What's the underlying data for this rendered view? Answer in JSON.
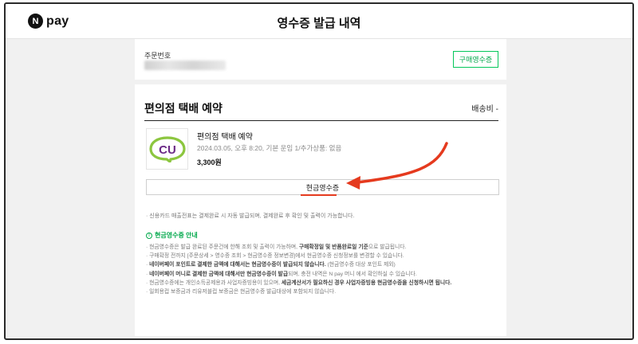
{
  "header": {
    "logo_n": "N",
    "logo_text": "pay",
    "title": "영수증 발급 내역"
  },
  "order": {
    "label": "주문번호",
    "purchase_receipt_button": "구매영수증"
  },
  "section": {
    "title": "편의점 택배 예약",
    "shipping_fee": "배송비 -"
  },
  "item": {
    "logo_text": "CU",
    "name": "편의점 택배 예약",
    "detail": "2024.03.05, 오후 8:20, 기본 운임 1/추가상품: 없음",
    "price": "3,300원"
  },
  "cash_receipt_button": "현금영수증",
  "notes": {
    "card_note": "· 신용카드 매출전표는 결제완료 시 자동 발급되며, 결제완료 후 확인 및 출력이 가능합니다."
  },
  "guide": {
    "icon": "!",
    "title": "현금영수증 안내",
    "items": [
      {
        "pre": "· 현금영수증은 발급 완료된 주문건에 한해 조회 및 출력이 가능하며, ",
        "bold": "구매확정일 및 반품완료일 기준",
        "post": "으로 발급됩니다."
      },
      {
        "pre": "· 구매확정 전까지 [주문상세 > 영수증 조회 > 현금영수증 정보변경]에서 현금영수증 신청정보를 변경할 수 있습니다.",
        "bold": "",
        "post": ""
      },
      {
        "pre": "· ",
        "bold": "네이버페이 포인트로 결제한 금액에 대해서는 현금영수증이 발급되지 않습니다.",
        "post": " (현금영수증 대상 포인트 제외)"
      },
      {
        "pre": "· ",
        "bold": "네이버페이 머니로 결제한 금액에 대해서만 현금영수증이 발급",
        "post": "되며, 충전 내역은 N pay 머니 에서 확인하실 수 있습니다."
      },
      {
        "pre": "· 현금영수증에는 개인소득공제용과 사업자증빙용이 있으며, ",
        "bold": "세금계산서가 필요하신 경우 사업자증빙용 현금영수증을 신청하시면 됩니다.",
        "post": ""
      },
      {
        "pre": "· 일회용컵 보증금과 리유저블컵 보증금은 현금영수증 발급대상에 포함되지 않습니다.",
        "bold": "",
        "post": ""
      }
    ]
  },
  "colors": {
    "brand_green": "#03c75a",
    "annotation_red": "#e53a1e",
    "cu_purple": "#6b2a86",
    "cu_green": "#8cc63f"
  }
}
